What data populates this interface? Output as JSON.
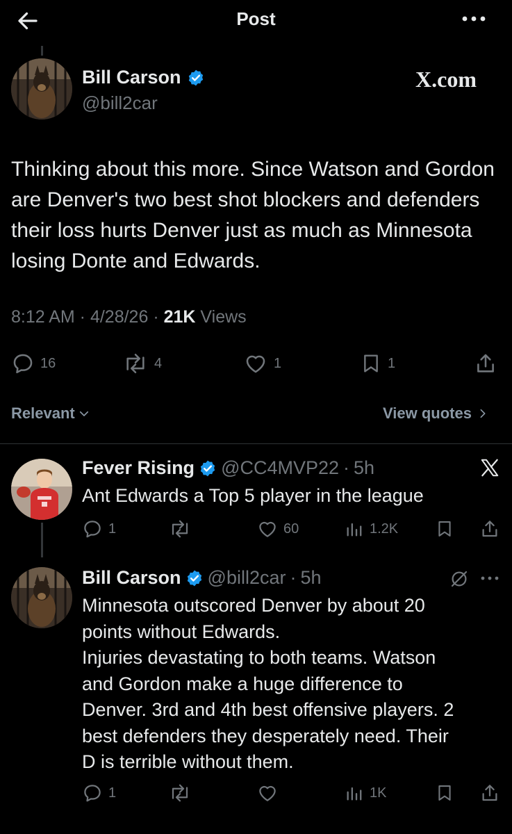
{
  "header": {
    "title": "Post"
  },
  "main_post": {
    "author_name": "Bill Carson",
    "author_handle": "@bill2car",
    "brand": "X.com",
    "text": "Thinking about this more.  Since Watson and Gordon are Denver's two best shot blockers and defenders their loss hurts Denver just as much as Minnesota losing Donte and Edwards.",
    "time": "8:12 AM",
    "date": "4/28/26",
    "views_count": "21K",
    "views_label": "Views",
    "replies": "16",
    "reposts": "4",
    "likes": "1",
    "bookmarks": "1"
  },
  "sort_label": "Relevant",
  "view_quotes_label": "View quotes",
  "replies": [
    {
      "name": "Fever Rising",
      "handle": "@CC4MVP22",
      "age": "5h",
      "text": "Ant Edwards a Top 5 player in the league",
      "replies": "1",
      "likes": "60",
      "views": "1.2K"
    },
    {
      "name": "Bill Carson",
      "handle": "@bill2car",
      "age": "5h",
      "lines": [
        "Minnesota outscored Denver by about 20",
        "points without Edwards.",
        "Injuries devastating to both teams. Watson",
        "and Gordon make a huge difference to",
        "Denver. 3rd and 4th best offensive players. 2",
        "best defenders they desperately need. Their",
        "D is terrible without them."
      ],
      "replies": "1",
      "views": "1K"
    }
  ],
  "colors": {
    "background": "#000000",
    "text": "#e7e9ea",
    "muted": "#71767b",
    "verified": "#1d9bf0"
  }
}
